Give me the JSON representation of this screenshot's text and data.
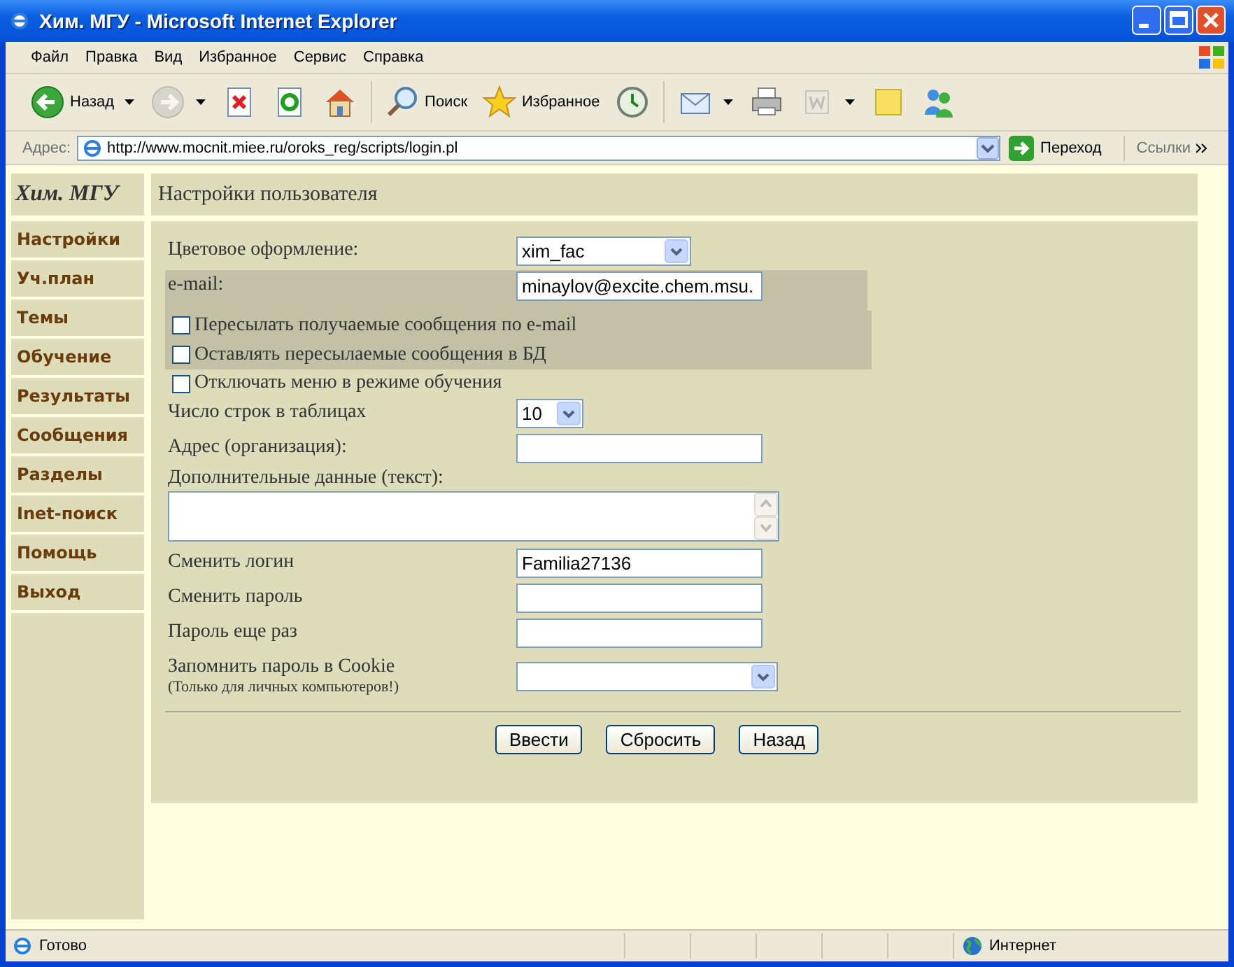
{
  "window": {
    "title": "Хим. МГУ - Microsoft Internet Explorer"
  },
  "menu_bar": [
    "Файл",
    "Правка",
    "Вид",
    "Избранное",
    "Сервис",
    "Справка"
  ],
  "toolbar": [
    {
      "label": "Назад",
      "dropdown": true,
      "disabled": false
    },
    {
      "dropdown": true,
      "disabled": true
    },
    {
      "dropdown": false,
      "disabled": false
    },
    {
      "dropdown": false,
      "disabled": false
    },
    {
      "dropdown": false,
      "disabled": false
    },
    {
      "label": "Поиск",
      "dropdown": false,
      "disabled": false
    },
    {
      "label": "Избранное",
      "dropdown": false,
      "disabled": false
    },
    {
      "dropdown": false,
      "disabled": false
    },
    {
      "dropdown": true,
      "disabled": false
    },
    {
      "dropdown": false,
      "disabled": false
    },
    {
      "dropdown": true,
      "disabled": true
    },
    {
      "dropdown": false,
      "disabled": false
    },
    {
      "dropdown": false,
      "disabled": false
    }
  ],
  "address_bar": {
    "label": "Адрес:",
    "url": "http://www.mocnit.miee.ru/oroks_reg/scripts/login.pl",
    "go": "Переход",
    "links": "Ссылки"
  },
  "sidebar": {
    "title": "Хим. МГУ",
    "items": [
      "Настройки",
      "Уч.план",
      "Темы",
      "Обучение",
      "Результаты",
      "Сообщения",
      "Разделы",
      "Inet-поиск",
      "Помощь",
      "Выход"
    ]
  },
  "main": {
    "title": "Настройки пользователя",
    "fields": [
      {
        "kind": "select",
        "label": "Цветовое оформление:",
        "value": "xim_fac",
        "shaded": false
      },
      {
        "kind": "text",
        "label": "e-mail:",
        "value": "minaylov@excite.chem.msu.",
        "shaded": true
      },
      {
        "kind": "checkbox",
        "label": "Пересылать получаемые сообщения по e-mail",
        "checked": false,
        "shaded": true
      },
      {
        "kind": "checkbox",
        "label": "Оставлять пересылаемые сообщения в БД",
        "checked": false,
        "shaded": true
      },
      {
        "kind": "checkbox",
        "label": "Отключать меню в режиме обучения",
        "checked": false,
        "shaded": false
      },
      {
        "kind": "select",
        "label": "Число строк в таблицах",
        "value": "10",
        "shaded": false
      },
      {
        "kind": "text",
        "label": "Адрес (организация):",
        "shaded": false
      },
      {
        "kind": "textarea",
        "label": "Дополнительные данные (текст):",
        "shaded": false
      },
      {
        "kind": "text",
        "label": "Сменить логин",
        "value": "Familia27136",
        "shaded": false
      },
      {
        "kind": "password",
        "label": "Сменить пароль",
        "shaded": false
      },
      {
        "kind": "password",
        "label": "Пароль еще раз",
        "shaded": false
      },
      {
        "kind": "select",
        "label": "Запомнить пароль в Cookie",
        "note": "(Только для личных компьютеров!)",
        "shaded": false
      }
    ],
    "buttons": [
      "Ввести",
      "Сбросить",
      "Назад"
    ]
  },
  "status_bar": {
    "text": "Готово",
    "zone": "Интернет"
  }
}
